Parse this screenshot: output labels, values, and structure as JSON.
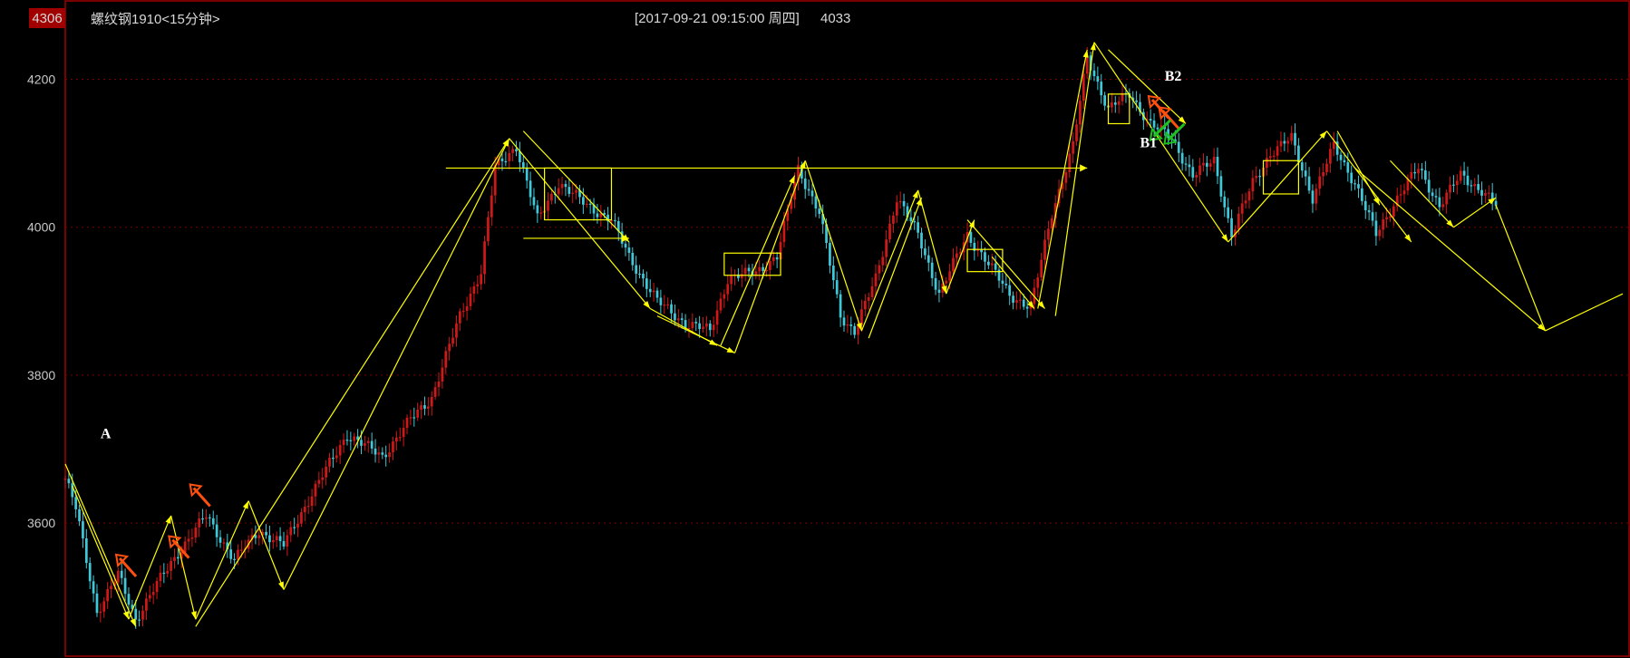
{
  "header": {
    "price_tag": "4306",
    "instrument": "螺纹钢1910<15分钟>",
    "datetime": "[2017-09-21  09:15:00 周四]",
    "price": "4033"
  },
  "colors": {
    "background": "#000000",
    "frame": "#b00000",
    "up": "#d01818",
    "down": "#40c8d8",
    "annotation": "#ffff00",
    "sell_arrow": "#ff5010",
    "buy_arrow": "#20c020"
  },
  "chart_data": {
    "type": "candlestick",
    "title": "螺纹钢1910<15分钟>",
    "ylim": [
      3420,
      4306
    ],
    "y_ticks": [
      4200,
      4000,
      3800,
      3600
    ],
    "grid": true,
    "gridline_style": "dotted",
    "price_path": [
      [
        0,
        3660
      ],
      [
        3,
        3620
      ],
      [
        9,
        3480
      ],
      [
        15,
        3530
      ],
      [
        20,
        3470
      ],
      [
        25,
        3510
      ],
      [
        32,
        3560
      ],
      [
        40,
        3610
      ],
      [
        48,
        3550
      ],
      [
        55,
        3590
      ],
      [
        62,
        3570
      ],
      [
        70,
        3640
      ],
      [
        80,
        3720
      ],
      [
        90,
        3690
      ],
      [
        98,
        3740
      ],
      [
        104,
        3770
      ],
      [
        112,
        3880
      ],
      [
        118,
        3940
      ],
      [
        122,
        4080
      ],
      [
        128,
        4110
      ],
      [
        134,
        4010
      ],
      [
        140,
        4060
      ],
      [
        148,
        4030
      ],
      [
        155,
        4010
      ],
      [
        160,
        3960
      ],
      [
        168,
        3900
      ],
      [
        176,
        3870
      ],
      [
        183,
        3860
      ],
      [
        188,
        3930
      ],
      [
        196,
        3940
      ],
      [
        202,
        3960
      ],
      [
        208,
        4080
      ],
      [
        214,
        4020
      ],
      [
        220,
        3880
      ],
      [
        224,
        3860
      ],
      [
        230,
        3930
      ],
      [
        236,
        4040
      ],
      [
        242,
        3990
      ],
      [
        248,
        3910
      ],
      [
        256,
        3990
      ],
      [
        262,
        3950
      ],
      [
        268,
        3910
      ],
      [
        274,
        3890
      ],
      [
        280,
        4020
      ],
      [
        286,
        4110
      ],
      [
        290,
        4230
      ],
      [
        296,
        4160
      ],
      [
        302,
        4180
      ],
      [
        308,
        4140
      ],
      [
        314,
        4120
      ],
      [
        320,
        4070
      ],
      [
        326,
        4090
      ],
      [
        331,
        3990
      ],
      [
        337,
        4060
      ],
      [
        342,
        4100
      ],
      [
        348,
        4120
      ],
      [
        354,
        4040
      ],
      [
        360,
        4110
      ],
      [
        366,
        4060
      ],
      [
        372,
        3990
      ],
      [
        378,
        4040
      ],
      [
        384,
        4080
      ],
      [
        390,
        4030
      ],
      [
        396,
        4070
      ],
      [
        402,
        4050
      ],
      [
        406,
        4030
      ]
    ],
    "tail_projection": [
      [
        406,
        4030
      ],
      [
        420,
        3860
      ],
      [
        442,
        3910
      ]
    ],
    "zigzag_segments": [
      [
        [
          0,
          3680
        ],
        [
          20,
          3460
        ]
      ],
      [
        [
          2,
          3650
        ],
        [
          18,
          3470
        ]
      ],
      [
        [
          18,
          3470
        ],
        [
          30,
          3610
        ]
      ],
      [
        [
          30,
          3610
        ],
        [
          37,
          3470
        ]
      ],
      [
        [
          37,
          3470
        ],
        [
          52,
          3630
        ]
      ],
      [
        [
          52,
          3630
        ],
        [
          62,
          3510
        ]
      ],
      [
        [
          37,
          3460
        ],
        [
          126,
          4120
        ]
      ],
      [
        [
          62,
          3510
        ],
        [
          126,
          4120
        ]
      ],
      [
        [
          130,
          4130
        ],
        [
          160,
          3980
        ]
      ],
      [
        [
          126,
          4120
        ],
        [
          166,
          3890
        ]
      ],
      [
        [
          166,
          3890
        ],
        [
          185,
          3840
        ]
      ],
      [
        [
          168,
          3880
        ],
        [
          190,
          3830
        ]
      ],
      [
        [
          190,
          3830
        ],
        [
          210,
          4090
        ]
      ],
      [
        [
          186,
          3840
        ],
        [
          207,
          4070
        ]
      ],
      [
        [
          210,
          4090
        ],
        [
          226,
          3860
        ]
      ],
      [
        [
          226,
          3860
        ],
        [
          242,
          4050
        ]
      ],
      [
        [
          228,
          3850
        ],
        [
          243,
          4040
        ]
      ],
      [
        [
          242,
          4050
        ],
        [
          250,
          3910
        ]
      ],
      [
        [
          250,
          3910
        ],
        [
          258,
          4010
        ]
      ],
      [
        [
          256,
          4010
        ],
        [
          278,
          3890
        ]
      ],
      [
        [
          263,
          3960
        ],
        [
          275,
          3890
        ]
      ],
      [
        [
          276,
          3890
        ],
        [
          290,
          4240
        ]
      ],
      [
        [
          281,
          3880
        ],
        [
          292,
          4250
        ]
      ],
      [
        [
          292,
          4250
        ],
        [
          330,
          3980
        ]
      ],
      [
        [
          296,
          4240
        ],
        [
          318,
          4140
        ]
      ],
      [
        [
          330,
          3980
        ],
        [
          358,
          4130
        ]
      ],
      [
        [
          358,
          4130
        ],
        [
          382,
          3980
        ]
      ],
      [
        [
          361,
          4130
        ],
        [
          373,
          4030
        ]
      ],
      [
        [
          376,
          4090
        ],
        [
          394,
          4000
        ]
      ],
      [
        [
          394,
          4000
        ],
        [
          406,
          4040
        ]
      ],
      [
        [
          366,
          4080
        ],
        [
          420,
          3860
        ]
      ]
    ],
    "horizontal_lines": [
      {
        "y": 4080,
        "x0": 108,
        "x1": 290
      },
      {
        "y": 3985,
        "x0": 130,
        "x1": 160
      }
    ],
    "boxes": [
      {
        "x0": 136,
        "x1": 155,
        "y0": 4010,
        "y1": 4080
      },
      {
        "x0": 187,
        "x1": 203,
        "y0": 3935,
        "y1": 3965
      },
      {
        "x0": 256,
        "x1": 266,
        "y0": 3940,
        "y1": 3970
      },
      {
        "x0": 296,
        "x1": 302,
        "y0": 4140,
        "y1": 4180
      },
      {
        "x0": 340,
        "x1": 350,
        "y0": 4045,
        "y1": 4090
      }
    ],
    "annotations": [
      {
        "text": "A",
        "x": 10,
        "y": 3715
      },
      {
        "text": "B2",
        "x": 312,
        "y": 4198
      },
      {
        "text": "B1",
        "x": 305,
        "y": 4108
      }
    ],
    "signal_arrows": [
      {
        "kind": "sell",
        "x": 17,
        "y": 3545
      },
      {
        "kind": "sell",
        "x": 32,
        "y": 3570
      },
      {
        "kind": "sell",
        "x": 38,
        "y": 3640
      },
      {
        "kind": "sell",
        "x": 310,
        "y": 4165
      },
      {
        "kind": "sell",
        "x": 313,
        "y": 4150
      },
      {
        "kind": "buy",
        "x": 310,
        "y": 4130
      },
      {
        "kind": "buy",
        "x": 314,
        "y": 4125
      }
    ]
  }
}
